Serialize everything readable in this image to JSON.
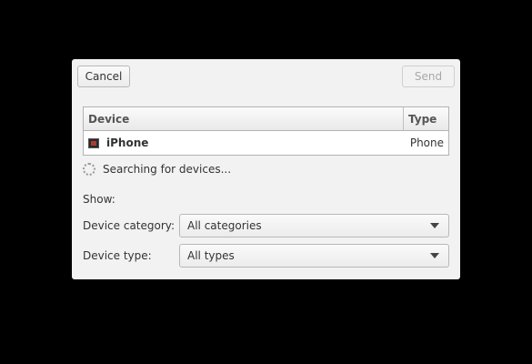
{
  "toolbar": {
    "cancel_label": "Cancel",
    "send_label": "Send"
  },
  "device_table": {
    "columns": [
      "Device",
      "Type"
    ],
    "rows": [
      {
        "name": "iPhone",
        "type": "Phone",
        "icon": "phone-device-icon"
      }
    ]
  },
  "status": {
    "text": "Searching for devices...",
    "icon": "spinner-icon"
  },
  "filters": {
    "show_label": "Show:",
    "category_label": "Device category:",
    "category_value": "All categories",
    "type_label": "Device type:",
    "type_value": "All types"
  }
}
